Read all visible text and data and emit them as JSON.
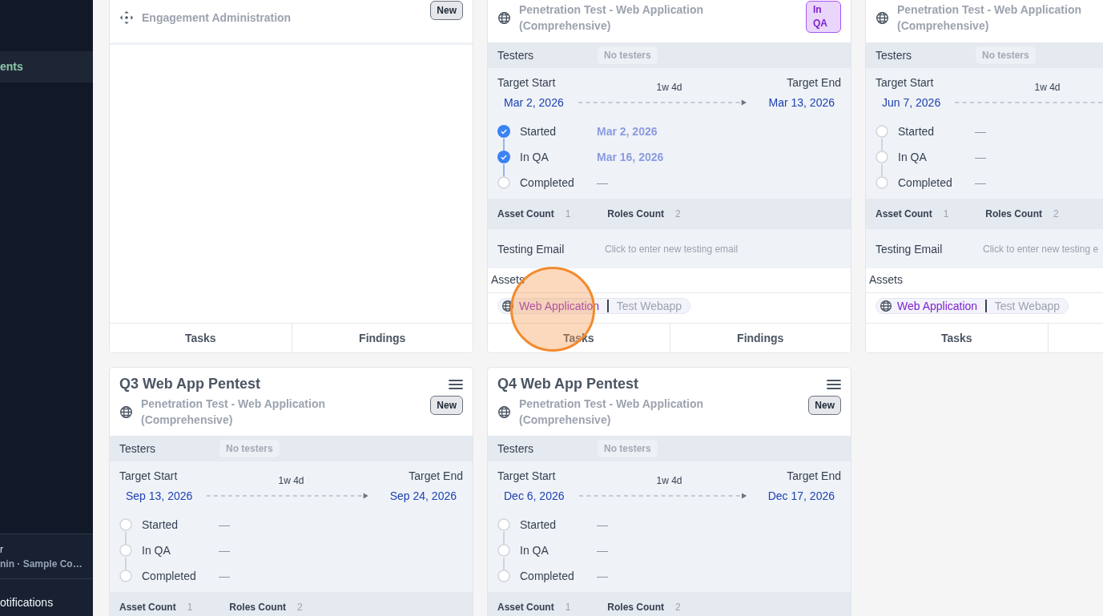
{
  "sidebar": {
    "items": [
      {
        "label": "ents",
        "selected": true
      }
    ],
    "user": {
      "name": "r",
      "detail": "nin · Sample Co…"
    },
    "notifications": "otifications"
  },
  "cards": [
    {
      "kind": "admin",
      "subtitle": "Engagement Administration",
      "badge": {
        "label": "New",
        "kind": "new"
      },
      "footer": [
        "Tasks",
        "Findings"
      ]
    },
    {
      "kind": "pentest",
      "subtitle": "Penetration Test - Web Application (Comprehensive)",
      "badge": {
        "label": "In QA",
        "kind": "in_qa"
      },
      "testers": {
        "label": "Testers",
        "value": "No testers"
      },
      "schedule": {
        "start_label": "Target Start",
        "duration": "1w 4d",
        "end_label": "Target End",
        "start": "Mar 2, 2026",
        "end": "Mar 13, 2026"
      },
      "milestones": [
        {
          "label": "Started",
          "done": true,
          "date": "Mar 2, 2026"
        },
        {
          "label": "In QA",
          "done": true,
          "date": "Mar 16, 2026"
        },
        {
          "label": "Completed",
          "done": false,
          "date": "—"
        }
      ],
      "counts": [
        {
          "label": "Asset Count",
          "value": "1"
        },
        {
          "label": "Roles Count",
          "value": "2"
        }
      ],
      "email": {
        "label": "Testing Email",
        "placeholder": "Click to enter new testing email"
      },
      "assets": {
        "label": "Assets",
        "items": [
          {
            "type": "Web Application",
            "name": "Test Webapp"
          }
        ]
      },
      "footer": [
        "Tasks",
        "Findings"
      ]
    },
    {
      "kind": "pentest",
      "subtitle": "Penetration Test - Web Application (Comprehensive)",
      "testers": {
        "label": "Testers",
        "value": "No testers"
      },
      "schedule": {
        "start_label": "Target Start",
        "duration": "1w 4d",
        "start": "Jun 7, 2026"
      },
      "milestones": [
        {
          "label": "Started",
          "done": false,
          "date": "—"
        },
        {
          "label": "In QA",
          "done": false,
          "date": "—"
        },
        {
          "label": "Completed",
          "done": false,
          "date": "—"
        }
      ],
      "counts": [
        {
          "label": "Asset Count",
          "value": "1"
        },
        {
          "label": "Roles Count",
          "value": "2"
        }
      ],
      "email": {
        "label": "Testing Email",
        "placeholder": "Click to enter new testing e"
      },
      "assets": {
        "label": "Assets",
        "items": [
          {
            "type": "Web Application",
            "name": "Test Webapp"
          }
        ]
      },
      "footer": [
        "Tasks"
      ]
    },
    {
      "title": "Q3 Web App Pentest",
      "menu": true,
      "kind": "pentest",
      "subtitle": "Penetration Test - Web Application (Comprehensive)",
      "badge": {
        "label": "New",
        "kind": "new"
      },
      "testers": {
        "label": "Testers",
        "value": "No testers"
      },
      "schedule": {
        "start_label": "Target Start",
        "duration": "1w 4d",
        "end_label": "Target End",
        "start": "Sep 13, 2026",
        "end": "Sep 24, 2026"
      },
      "milestones": [
        {
          "label": "Started",
          "done": false,
          "date": "—"
        },
        {
          "label": "In QA",
          "done": false,
          "date": "—"
        },
        {
          "label": "Completed",
          "done": false,
          "date": "—"
        }
      ],
      "counts": [
        {
          "label": "Asset Count",
          "value": "1"
        },
        {
          "label": "Roles Count",
          "value": "2"
        }
      ]
    },
    {
      "title": "Q4 Web App Pentest",
      "menu": true,
      "kind": "pentest",
      "subtitle": "Penetration Test - Web Application (Comprehensive)",
      "badge": {
        "label": "New",
        "kind": "new"
      },
      "testers": {
        "label": "Testers",
        "value": "No testers"
      },
      "schedule": {
        "start_label": "Target Start",
        "duration": "1w 4d",
        "end_label": "Target End",
        "start": "Dec 6, 2026",
        "end": "Dec 17, 2026"
      },
      "milestones": [
        {
          "label": "Started",
          "done": false,
          "date": "—"
        },
        {
          "label": "In QA",
          "done": false,
          "date": "—"
        },
        {
          "label": "Completed",
          "done": false,
          "date": "—"
        }
      ],
      "counts": [
        {
          "label": "Asset Count",
          "value": "1"
        },
        {
          "label": "Roles Count",
          "value": "2"
        }
      ]
    }
  ],
  "click_indicator": true
}
